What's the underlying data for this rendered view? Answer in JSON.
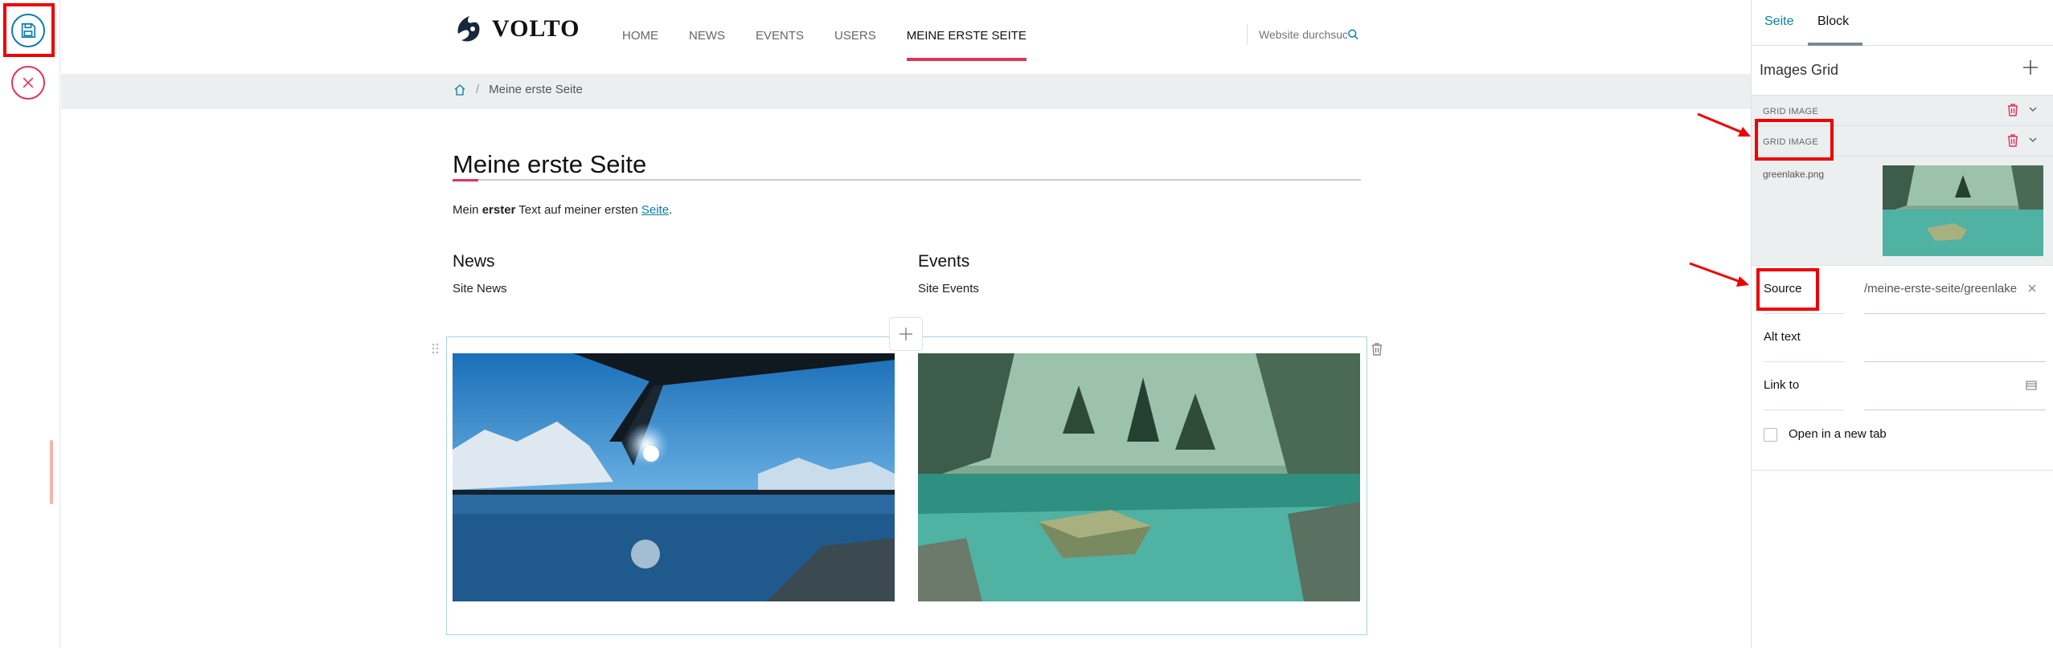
{
  "toolbar": {
    "save_icon": "floppy-disk-icon",
    "cancel_icon": "close-circle-icon",
    "accent_save": "#0a7ea8",
    "accent_cancel": "#e0345b"
  },
  "header": {
    "logo_text": "VOLTO",
    "nav": [
      {
        "label": "HOME"
      },
      {
        "label": "NEWS"
      },
      {
        "label": "EVENTS"
      },
      {
        "label": "USERS"
      },
      {
        "label": "MEINE ERSTE SEITE",
        "active": true
      }
    ],
    "search_placeholder": "Website durchsuchen"
  },
  "breadcrumb": {
    "home_icon": "home-icon",
    "current": "Meine erste Seite"
  },
  "main": {
    "title": "Meine erste Seite",
    "intro_prefix": "Mein ",
    "intro_bold": "erster",
    "intro_middle": " Text auf meiner ersten ",
    "intro_link": "Seite",
    "intro_suffix": ".",
    "news_title": "News",
    "news_sub": "Site News",
    "events_title": "Events",
    "events_sub": "Site Events"
  },
  "sidebar": {
    "tabs": [
      {
        "label": "Seite"
      },
      {
        "label": "Block",
        "active": true
      }
    ],
    "block_title": "Images Grid",
    "grid_items": [
      {
        "label": "GRID IMAGE"
      },
      {
        "label": "GRID IMAGE"
      }
    ],
    "preview_filename": "greenlake.png",
    "source_label": "Source",
    "source_value": "/meine-erste-seite/greenlake.png",
    "alt_label": "Alt text",
    "alt_value": "",
    "link_label": "Link to",
    "link_value": "",
    "newtab_label": "Open in a new tab",
    "newtab_checked": false
  }
}
